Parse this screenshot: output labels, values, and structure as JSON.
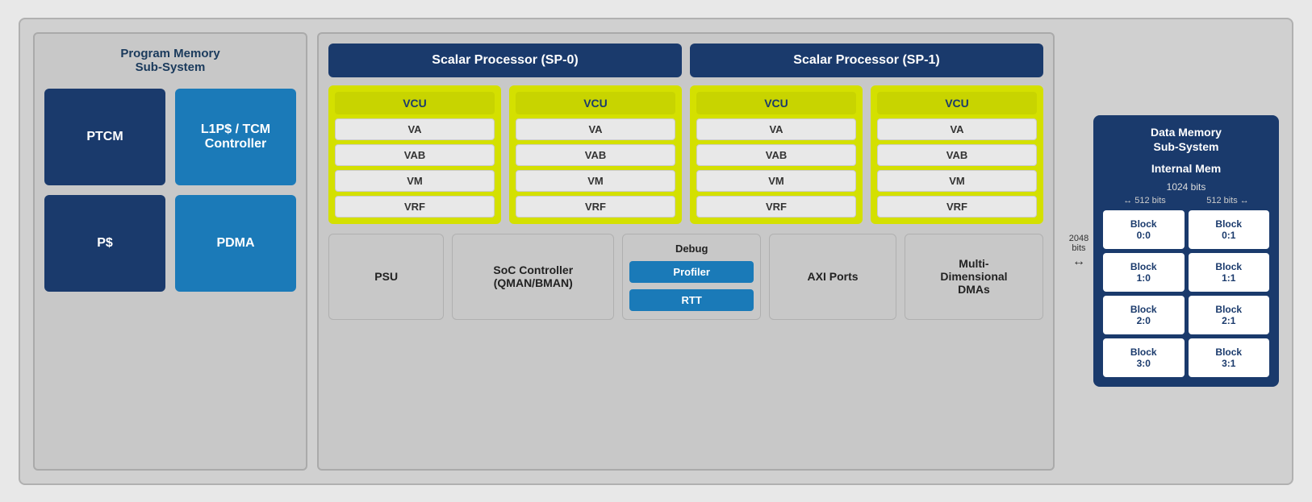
{
  "left": {
    "title": "Program Memory\nSub-System",
    "blocks": [
      {
        "id": "ptcm",
        "label": "PTCM",
        "style": "dark"
      },
      {
        "id": "l1p",
        "label": "L1P$ / TCM\nController",
        "style": "teal"
      },
      {
        "id": "ps",
        "label": "P$",
        "style": "dark"
      },
      {
        "id": "pdma",
        "label": "PDMA",
        "style": "teal"
      }
    ]
  },
  "center": {
    "sp0": {
      "label": "Scalar Processor (SP-0)"
    },
    "sp1": {
      "label": "Scalar Processor (SP-1)"
    },
    "vcus": [
      {
        "label": "VCU",
        "subs": [
          "VA",
          "VAB",
          "VM",
          "VRF"
        ]
      },
      {
        "label": "VCU",
        "subs": [
          "VA",
          "VAB",
          "VM",
          "VRF"
        ]
      },
      {
        "label": "VCU",
        "subs": [
          "VA",
          "VAB",
          "VM",
          "VRF"
        ]
      },
      {
        "label": "VCU",
        "subs": [
          "VA",
          "VAB",
          "VM",
          "VRF"
        ]
      }
    ],
    "bottom": {
      "psu": "PSU",
      "soc": "SoC Controller\n(QMAN/BMAN)",
      "debug_title": "Debug",
      "profiler": "Profiler",
      "rtt": "RTT",
      "axi": "AXI Ports",
      "dma": "Multi-\nDimensional\nDMAs"
    }
  },
  "right": {
    "title": "Data Memory\nSub-System",
    "internal_mem": "Internal Mem",
    "bits_2048": "2048\nbits",
    "bits_1024": "1024 bits",
    "bits_512_left": "512 bits",
    "bits_512_right": "512 bits",
    "blocks": [
      {
        "id": "b00",
        "label": "Block\n0:0"
      },
      {
        "id": "b01",
        "label": "Block\n0:1"
      },
      {
        "id": "b10",
        "label": "Block\n1:0"
      },
      {
        "id": "b11",
        "label": "Block\n1:1"
      },
      {
        "id": "b20",
        "label": "Block\n2:0"
      },
      {
        "id": "b21",
        "label": "Block\n2:1"
      },
      {
        "id": "b30",
        "label": "Block\n3:0"
      },
      {
        "id": "b31",
        "label": "Block\n3:1"
      }
    ]
  }
}
